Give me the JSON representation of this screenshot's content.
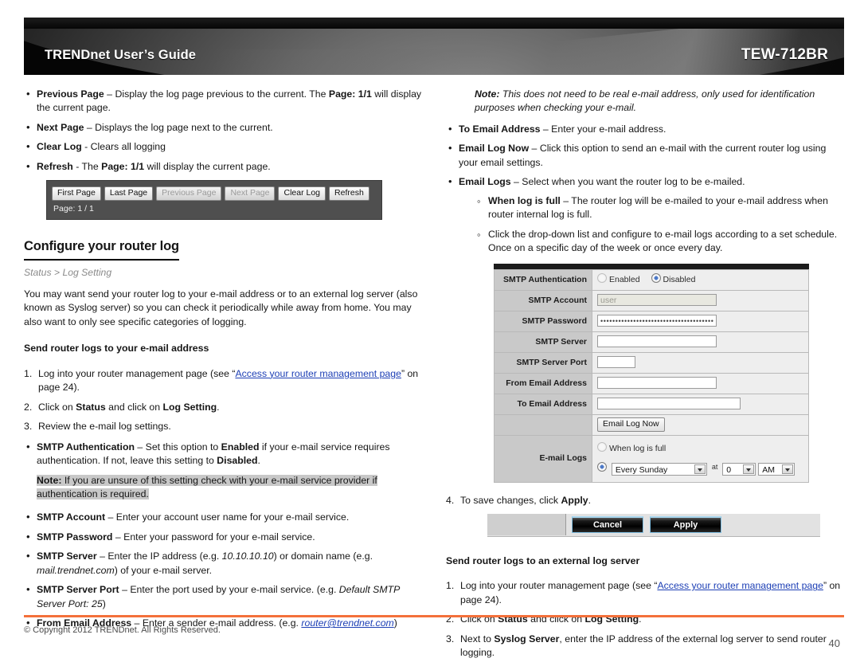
{
  "header": {
    "brand": "TRENDnet User’s Guide",
    "model": "TEW-712BR"
  },
  "left_column": {
    "bullets_top": [
      {
        "term": "Previous Page",
        "dash": " – ",
        "text_a": "Display the log page previous to the current. The ",
        "bold_b": "Page: 1/1",
        "text_c": " will display the current page."
      },
      {
        "term": "Next Page",
        "dash": " – ",
        "text_a": "Displays the log page next to the current.",
        "bold_b": "",
        "text_c": ""
      },
      {
        "term": "Clear Log",
        "dash": "  - ",
        "text_a": "Clears all logging",
        "bold_b": "",
        "text_c": ""
      },
      {
        "term": "Refresh",
        "dash": " - ",
        "text_a": "The ",
        "bold_b": "Page: 1/1",
        "text_c": " will display the current page."
      }
    ],
    "log_toolbar": {
      "buttons": [
        {
          "label": "First Page",
          "disabled": false
        },
        {
          "label": "Last Page",
          "disabled": false
        },
        {
          "label": "Previous Page",
          "disabled": true
        },
        {
          "label": "Next Page",
          "disabled": true
        },
        {
          "label": "Clear Log",
          "disabled": false
        },
        {
          "label": "Refresh",
          "disabled": false
        }
      ],
      "page_status": "Page: 1 / 1"
    },
    "section_title": "Configure your router log",
    "breadcrumb": "Status > Log Setting",
    "paragraph": "You may want send your router log to your e-mail address or to an external log server (also known as Syslog server) so you can check it periodically while away from home. You may also want to only see specific categories of logging.",
    "subhead": "Send router logs to your e-mail address",
    "steps": {
      "step1_a": "Log into your router management page (see “",
      "step1_link": "Access your router management page",
      "step1_b": "” on page 24).",
      "step2_a": "Click on ",
      "step2_bold1": "Status",
      "step2_b": " and click on ",
      "step2_bold2": "Log Setting",
      "step2_c": ".",
      "step3": "Review the e-mail log settings."
    },
    "smtp_auth_bullet": {
      "term": "SMTP Authentication",
      "text_a": " – Set this option to ",
      "bold_b": "Enabled",
      "text_c": " if your e-mail service requires authentication. If not, leave this setting to ",
      "bold_d": "Disabled",
      "text_e": "."
    },
    "auth_note": {
      "label": "Note:",
      "text": " If you are unsure of this setting check with your e-mail service provider if authentication is required."
    },
    "bullets_bottom": [
      {
        "term": "SMTP Account",
        "text": " – Enter your account user name for your e-mail service."
      },
      {
        "term": "SMTP Password",
        "text": " – Enter your password for your e-mail service."
      }
    ],
    "smtp_server_bullet": {
      "term": "SMTP Server",
      "text_a": " – Enter the IP address (e.g. ",
      "ital_b": "10.10.10.10",
      "text_c": ") or domain name (e.g. ",
      "ital_d": "mail.trendnet.com",
      "text_e": ") of your e-mail server."
    },
    "smtp_port_bullet": {
      "term": "SMTP Server Port",
      "text_a": " – Enter the port used by your e-mail service. (e.g. ",
      "ital_b": "Default SMTP Server Port: 25",
      "text_c": ")"
    },
    "from_email_bullet": {
      "term": "From Email Address",
      "text_a": " – Enter a sender e-mail address. (e.g. ",
      "link_b": "router@trendnet.com",
      "text_c": ")"
    }
  },
  "right_column": {
    "top_note": {
      "label": "Note:",
      "text": " This does not need to be real e-mail address, only used for identification purposes when checking your e-mail."
    },
    "bullets": [
      {
        "term": "To Email Address",
        "text": " – Enter your e-mail address."
      },
      {
        "term": "Email Log Now",
        "text": " – Click this option to send an e-mail with the current router log using your email settings."
      },
      {
        "term": "Email Logs",
        "text": " – Select when you want the router log to be e-mailed."
      }
    ],
    "sub_bullets": [
      {
        "term": "When log is full",
        "text": " – The router log will be e-mailed to your e-mail address when router internal log is full."
      },
      {
        "term": "",
        "text": "Click the drop-down list and configure to e-mail logs according to a set schedule. Once on a specific day of the week or once every day."
      }
    ],
    "smtp_form": {
      "rows": [
        {
          "label": "SMTP Authentication",
          "type": "radio-pair",
          "option1": "Enabled",
          "option2": "Disabled",
          "selected": "Disabled"
        },
        {
          "label": "SMTP Account",
          "type": "text",
          "value": "user",
          "disabled": true
        },
        {
          "label": "SMTP Password",
          "type": "password",
          "value": "••••••••••••••••••••••••••••••••••••••",
          "disabled": false
        },
        {
          "label": "SMTP Server",
          "type": "text",
          "value": "",
          "disabled": false
        },
        {
          "label": "SMTP Server Port",
          "type": "text-small",
          "value": "",
          "disabled": false
        },
        {
          "label": "From Email Address",
          "type": "text",
          "value": "",
          "disabled": false
        },
        {
          "label": "To Email Address",
          "type": "text-wide",
          "value": "",
          "disabled": false
        },
        {
          "label": "",
          "type": "button",
          "value": "Email Log Now"
        },
        {
          "label": "E-mail Logs",
          "type": "schedule",
          "radio1_label": "When log is full",
          "day_value": "Every Sunday",
          "at_label": "at",
          "hour_value": "0",
          "ampm_value": "AM",
          "selected": "schedule"
        }
      ]
    },
    "apply_step": {
      "text_a": "To save changes, click ",
      "bold_b": "Apply",
      "text_c": "."
    },
    "buttons": {
      "cancel": "Cancel",
      "apply": "Apply"
    },
    "subhead2": "Send router logs to an external log server",
    "steps2": {
      "step1_a": "Log into your router management page (see “",
      "step1_link": "Access your router management page",
      "step1_b": "” on page 24).",
      "step2_a": "Click on ",
      "step2_bold1": "Status",
      "step2_b": " and click on ",
      "step2_bold2": "Log Setting",
      "step2_c": ".",
      "step3_a": "Next to ",
      "step3_bold": "Syslog Server",
      "step3_b": ", enter the IP address of the external log server to send router logging."
    }
  },
  "footer": {
    "copyright": "© Copyright 2012 TRENDnet. All Rights Reserved.",
    "page_number": "40"
  }
}
